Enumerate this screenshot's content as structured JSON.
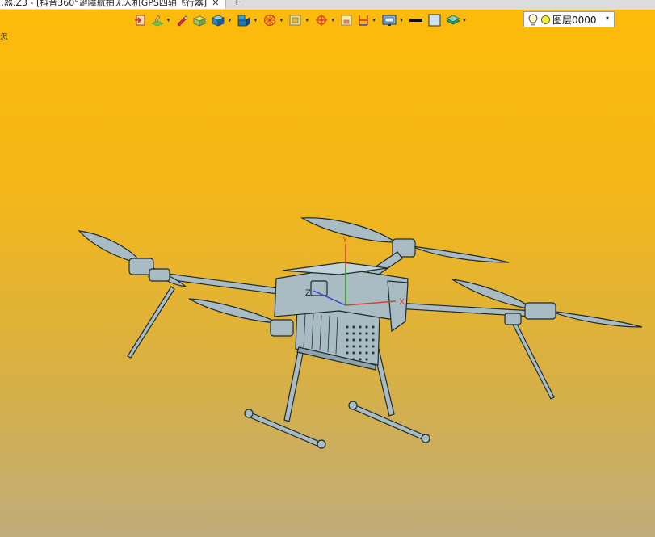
{
  "tab": {
    "title": "…器.Z3 - [抖音360°避障航拍无人机GPS四轴飞行器]",
    "close_glyph": "✕",
    "new_tab_glyph": "+"
  },
  "viewport": {
    "hint": "怎"
  },
  "toolbar": {
    "items": [
      {
        "icon": "exit-sketch-icon",
        "dropdown": false
      },
      {
        "icon": "sketch-plane-icon",
        "dropdown": true
      },
      {
        "icon": "pencil-icon",
        "dropdown": false
      },
      {
        "icon": "block-icon",
        "dropdown": false
      },
      {
        "icon": "shaded-box-icon",
        "dropdown": true
      },
      {
        "icon": "view-cube-icon",
        "dropdown": true
      },
      {
        "icon": "wheel-icon",
        "dropdown": true
      },
      {
        "icon": "frame-icon",
        "dropdown": true
      },
      {
        "icon": "target-icon",
        "dropdown": true
      },
      {
        "icon": "square-icon",
        "dropdown": false
      },
      {
        "icon": "measure-icon",
        "dropdown": true
      },
      {
        "icon": "display-icon",
        "dropdown": true
      },
      {
        "icon": "line-color-icon",
        "dropdown": false
      },
      {
        "icon": "fill-color-icon",
        "dropdown": false
      },
      {
        "icon": "layers-icon",
        "dropdown": true
      }
    ]
  },
  "layer_select": {
    "value": "图层0000",
    "arrow": "▾"
  },
  "colors": {
    "bg_top": "#fdbb0a",
    "bg_bottom": "#bfac7a",
    "model_fill": "#a9bcc4",
    "model_edge": "#1c2a30"
  },
  "model": {
    "axis_x": "X",
    "axis_z": "Z",
    "axis_y": "Y"
  }
}
